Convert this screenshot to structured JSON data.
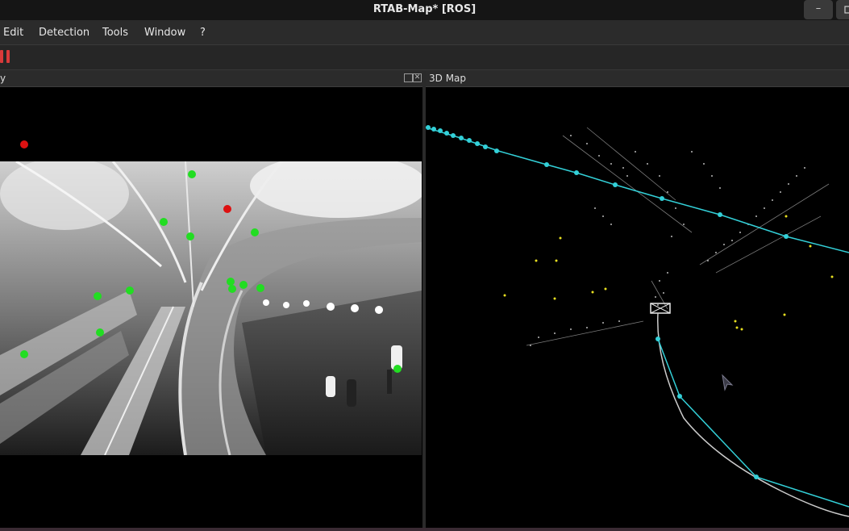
{
  "window": {
    "title": "RTAB-Map* [ROS]",
    "minimize_label": "–"
  },
  "menu": {
    "items": [
      {
        "label": "Edit"
      },
      {
        "label": "Detection"
      },
      {
        "label": "Tools"
      },
      {
        "label": "Window"
      },
      {
        "label": "?"
      }
    ]
  },
  "toolbar": {
    "pause_icon": "pause-icon"
  },
  "panels": {
    "left": {
      "title": "y"
    },
    "right": {
      "title": "3D Map"
    }
  },
  "colors": {
    "feature_green": "#22dd22",
    "feature_red": "#dd1111",
    "trajectory_cyan": "#33d0d8",
    "point_cloud": "#d8d8d8",
    "loop_yellow": "#e8e020"
  }
}
